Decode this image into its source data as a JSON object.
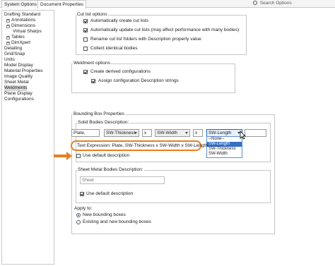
{
  "tabs": [
    "System Options",
    "Document Properties"
  ],
  "search_placeholder": "Search Options",
  "tree": [
    {
      "label": "Drafting Standard",
      "level": 0,
      "exp": false
    },
    {
      "label": "Annotations",
      "level": 1,
      "exp": true
    },
    {
      "label": "Dimensions",
      "level": 1,
      "exp": true
    },
    {
      "label": "Virtual Sharps",
      "level": 1,
      "exp": false
    },
    {
      "label": "Tables",
      "level": 1,
      "exp": true
    },
    {
      "label": "DimXpert",
      "level": 1,
      "exp": true
    },
    {
      "label": "Detailing",
      "level": 0,
      "exp": false
    },
    {
      "label": "Grid/Snap",
      "level": 0,
      "exp": false
    },
    {
      "label": "Units",
      "level": 0,
      "exp": false
    },
    {
      "label": "Model Display",
      "level": 0,
      "exp": false
    },
    {
      "label": "Material Properties",
      "level": 0,
      "exp": false
    },
    {
      "label": "Image Quality",
      "level": 0,
      "exp": false
    },
    {
      "label": "Sheet Metal",
      "level": 0,
      "exp": false
    },
    {
      "label": "Weldments",
      "level": 0,
      "exp": false,
      "selected": true
    },
    {
      "label": "Plane Display",
      "level": 0,
      "exp": false
    },
    {
      "label": "Configurations",
      "level": 0,
      "exp": false
    }
  ],
  "cut_list": {
    "title": "Cut list options",
    "opt1": "Automatically create cut lists",
    "opt2": "Automatically update cut lists (may affect performance with many bodies)",
    "opt3": "Rename cut list folders with Description property value",
    "opt4": "Collect identical bodies"
  },
  "weldment": {
    "title": "Weldment options",
    "opt1": "Create derived configurations",
    "opt2": "Assign configuration Description strings"
  },
  "bbox": {
    "title": "Bounding Box Properties",
    "solid_title": "Solid Bodies Description:",
    "field1": "Plate,",
    "combo1": "SW-Thickness",
    "sep1": "x",
    "combo2": "SW-Width",
    "sep2": "x",
    "combo3": "SW-Length",
    "dropdown": [
      "--None--",
      "SW-Length",
      "SW-Thickness",
      "SW-Width"
    ],
    "expression": "Text Expression: Plate, SW-Thickness x SW-Width x SW-Length",
    "use_default": "Use default description",
    "sheet_title": "Sheet Metal Bodies Description:",
    "sheet_value": "Sheet",
    "sheet_default": "Use default description",
    "apply_title": "Apply to:",
    "apply_new": "New bounding boxes",
    "apply_existing": "Existing and new bounding boxes"
  }
}
